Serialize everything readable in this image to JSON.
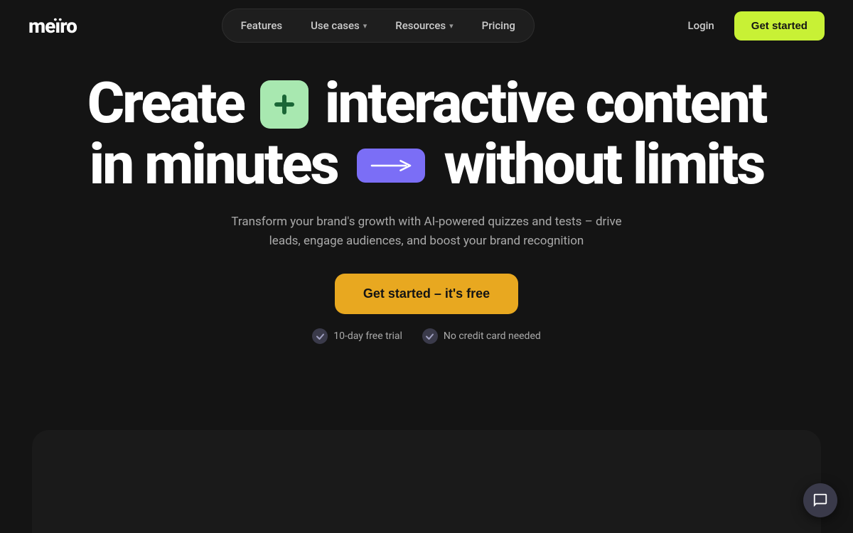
{
  "logo": {
    "text": "meïro"
  },
  "nav": {
    "links": [
      {
        "id": "features",
        "label": "Features",
        "hasDropdown": false
      },
      {
        "id": "use-cases",
        "label": "Use cases",
        "hasDropdown": true
      },
      {
        "id": "resources",
        "label": "Resources",
        "hasDropdown": true
      },
      {
        "id": "pricing",
        "label": "Pricing",
        "hasDropdown": false
      }
    ],
    "login_label": "Login",
    "get_started_label": "Get started"
  },
  "hero": {
    "line1_start": "Create",
    "line1_end": "interactive content",
    "line2_start": "in minutes",
    "line2_end": "without limits",
    "subtitle": "Transform your brand's growth with AI-powered quizzes and tests – drive leads, engage audiences, and boost your brand recognition",
    "cta_label": "Get started – it's free",
    "trust_items": [
      {
        "id": "trial",
        "label": "10-day free trial"
      },
      {
        "id": "no-cc",
        "label": "No credit card needed"
      }
    ]
  }
}
